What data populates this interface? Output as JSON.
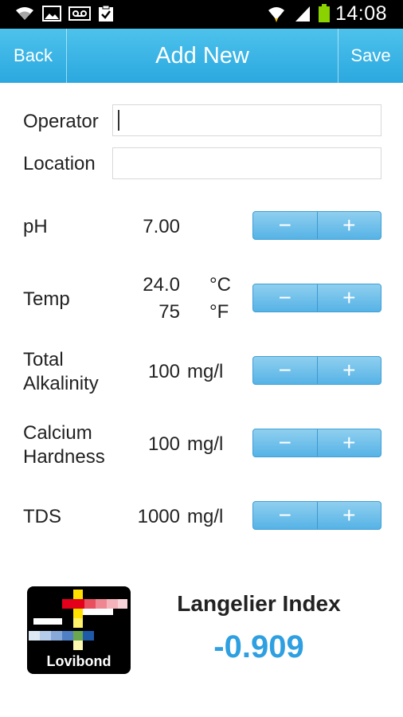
{
  "status_bar": {
    "time": "14:08",
    "icons": [
      "wifi-icon",
      "image-icon",
      "voicemail-icon",
      "clipboard-check-icon",
      "wifi-signal-icon",
      "cell-signal-icon",
      "battery-icon"
    ]
  },
  "action_bar": {
    "back_label": "Back",
    "title": "Add New",
    "save_label": "Save"
  },
  "form": {
    "operator": {
      "label": "Operator",
      "value": "",
      "placeholder": ""
    },
    "location": {
      "label": "Location",
      "value": "",
      "placeholder": ""
    }
  },
  "params": {
    "ph": {
      "label": "pH",
      "value": "7.00"
    },
    "temp": {
      "label": "Temp",
      "value_c": "24.0",
      "unit_c": "°C",
      "value_f": "75",
      "unit_f": "°F"
    },
    "alkalinity": {
      "label_line1": "Total",
      "label_line2": "Alkalinity",
      "value": "100",
      "unit": "mg/l"
    },
    "calcium": {
      "label_line1": "Calcium",
      "label_line2": "Hardness",
      "value": "100",
      "unit": "mg/l"
    },
    "tds": {
      "label": "TDS",
      "value": "1000",
      "unit": "mg/l"
    }
  },
  "stepper": {
    "minus": "−",
    "plus": "+"
  },
  "result": {
    "logo_text": "Lovibond",
    "title": "Langelier Index",
    "value": "-0.909"
  },
  "colors": {
    "accent": "#2e9fe0",
    "action_bar": "#2ba8df",
    "stepper": "#56b3e6"
  }
}
